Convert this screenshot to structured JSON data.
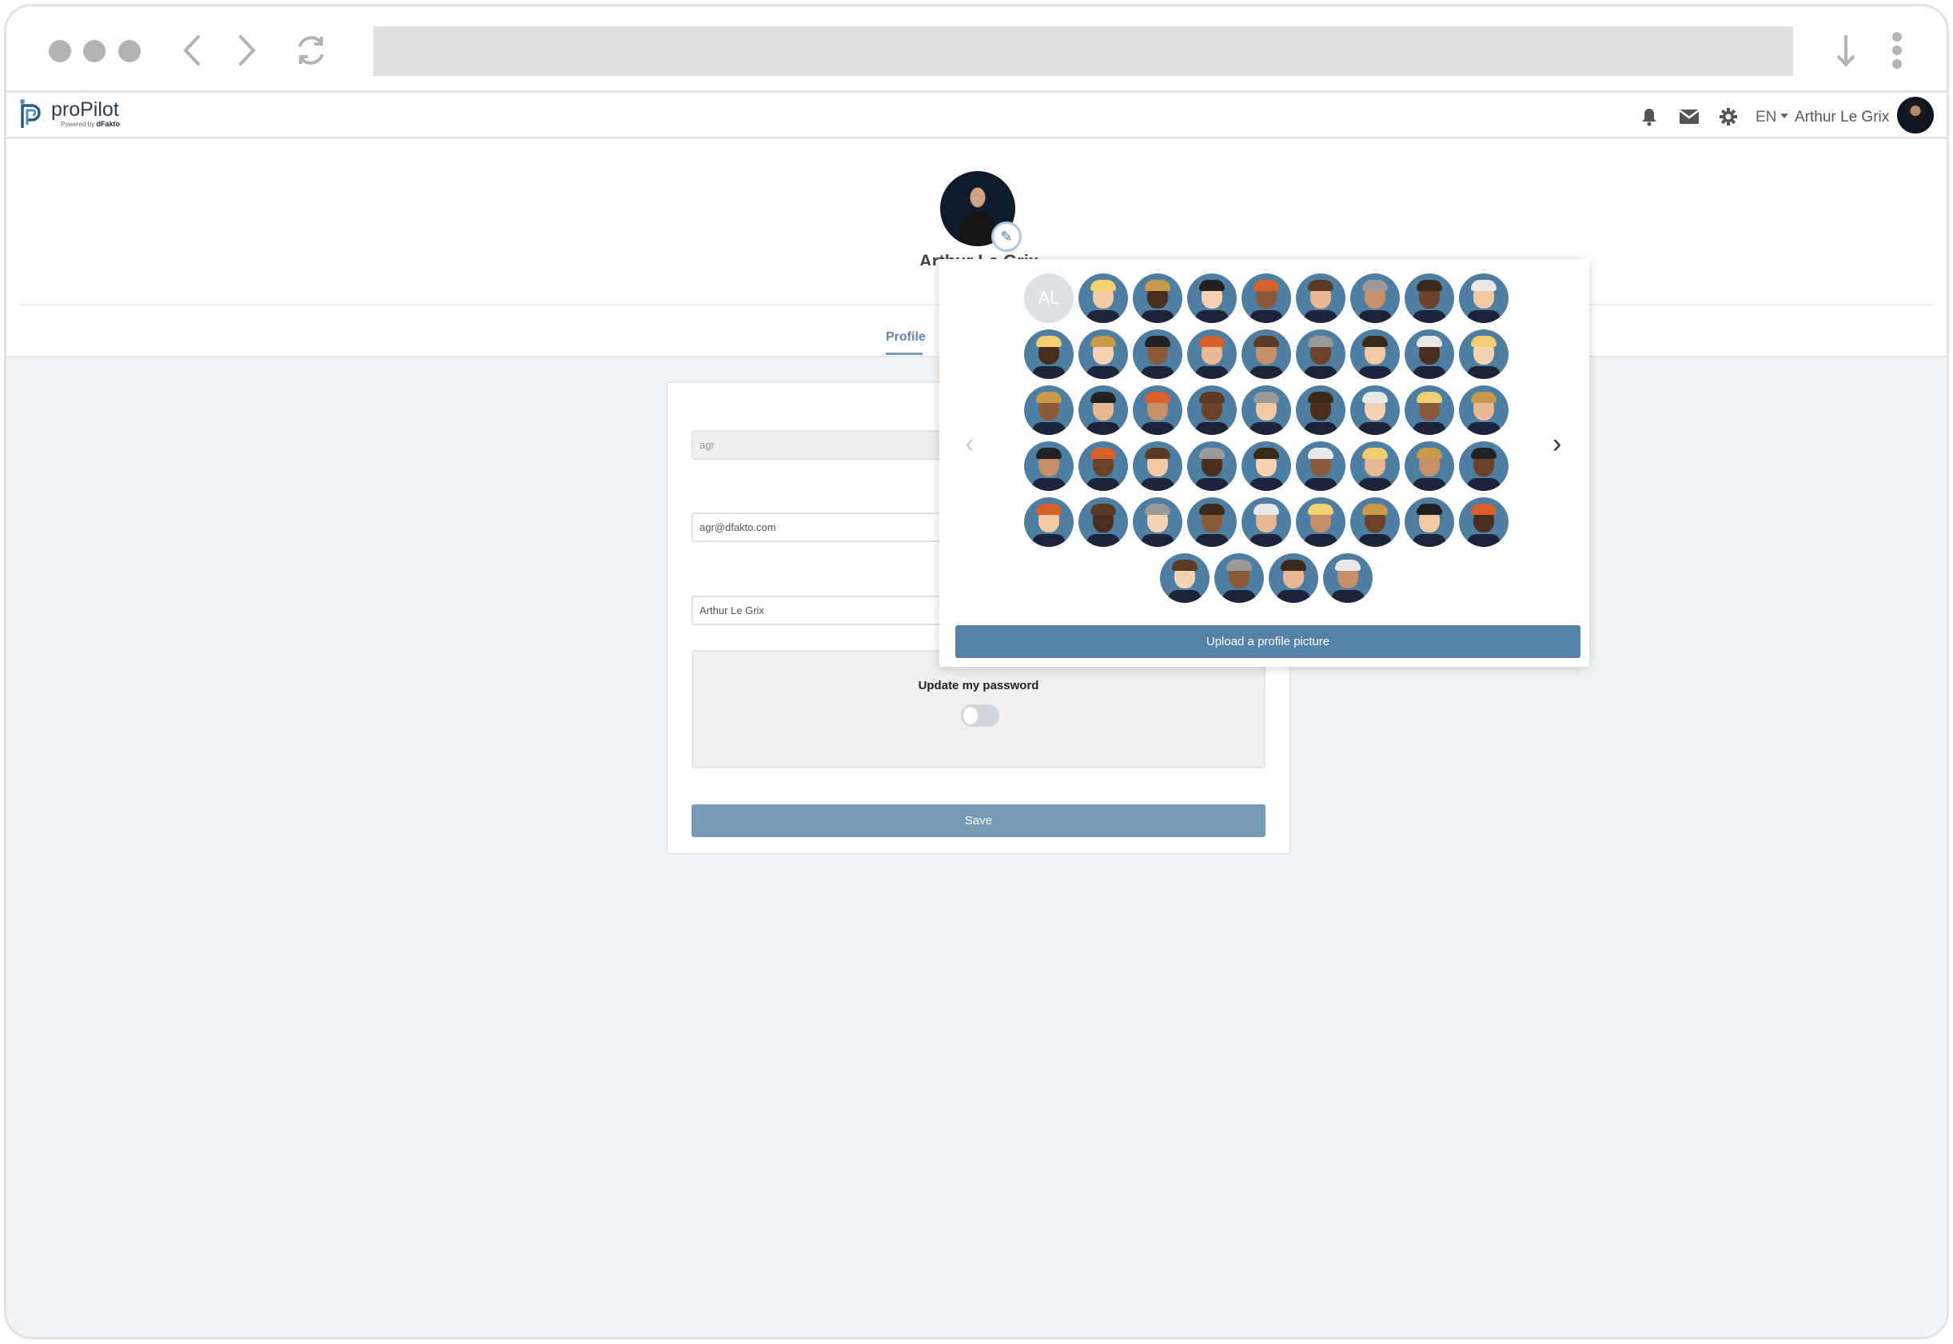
{
  "browser": {
    "window_controls": [
      "dot",
      "dot",
      "dot"
    ],
    "back_icon": "chevron-left-icon",
    "forward_icon": "chevron-right-icon",
    "reload_icon": "reload-icon",
    "address_value": "",
    "download_icon": "download-icon",
    "menu_icon": "kebab-menu-icon"
  },
  "header": {
    "logo_name": "proPilot",
    "logo_powered": "Powered by",
    "logo_brand": "dFakto",
    "language": "EN",
    "user_name": "Arthur Le Grix",
    "icons": [
      "bell-icon",
      "mail-icon",
      "gear-icon"
    ]
  },
  "profile": {
    "name": "Arthur Le Grix",
    "tabs": [
      {
        "label": "Profile",
        "active": true
      }
    ]
  },
  "form": {
    "username_value": "agr",
    "email_value": "agr@dfakto.com",
    "fullname_value": "Arthur Le Grix",
    "password_label": "Update my password",
    "password_toggle_on": false,
    "save_label": "Save"
  },
  "avatar_picker": {
    "initials": "AL",
    "avatar_rows": [
      9,
      9,
      9,
      9,
      9,
      4
    ],
    "upload_label": "Upload a profile picture",
    "prev_icon": "chevron-left-icon",
    "next_icon": "chevron-right-icon"
  },
  "colors": {
    "accent": "#5481a5",
    "save": "#769bb7",
    "avatar_bg": "#4f7ea3",
    "page_bg": "#f2f5f7"
  }
}
